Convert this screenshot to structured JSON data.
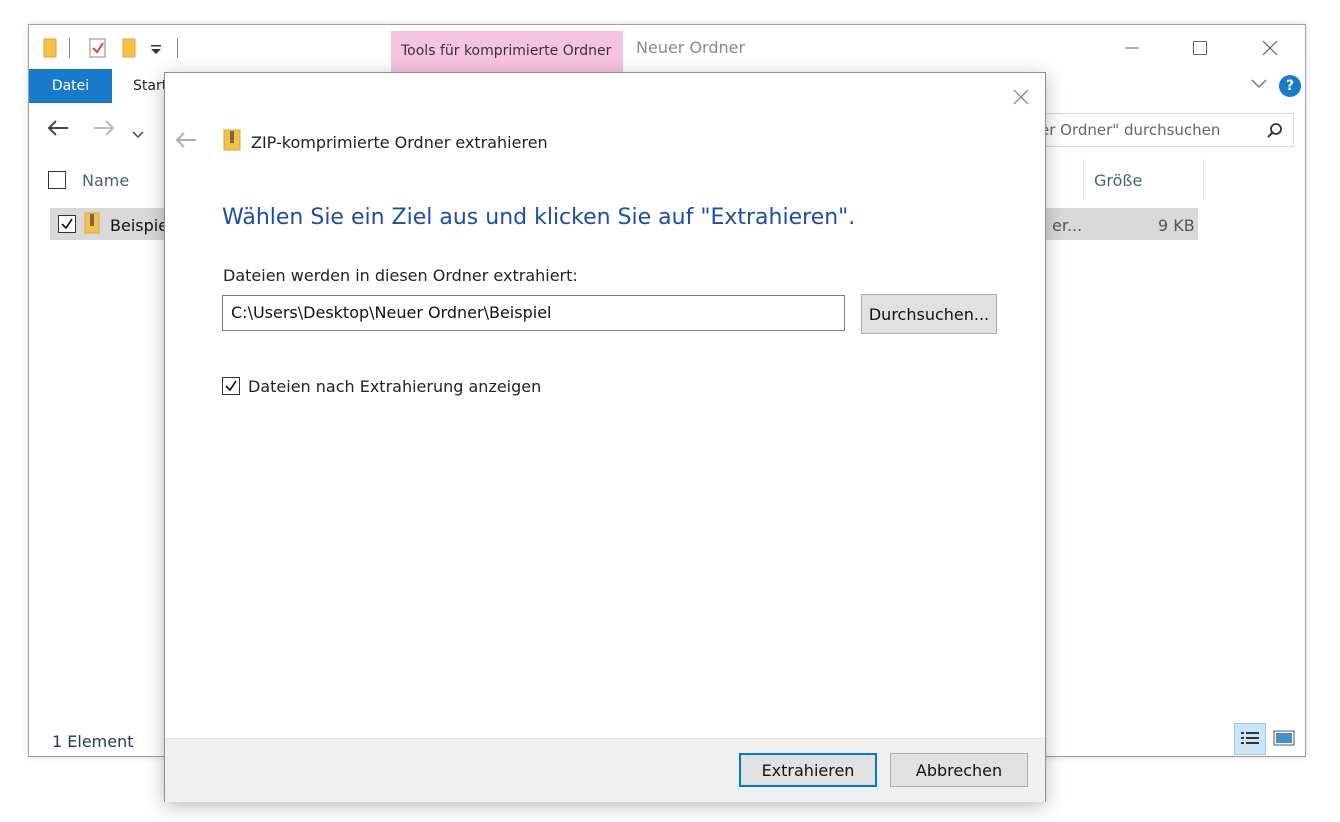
{
  "explorer": {
    "context_tab": "Tools für komprimierte Ordner",
    "window_title": "Neuer Ordner",
    "ribbon_tabs": [
      "Datei",
      "Start"
    ],
    "search_placeholder": "er Ordner\" durchsuchen",
    "columns": {
      "name": "Name",
      "size": "Größe"
    },
    "file": {
      "name": "Beispie",
      "type_partial": "er...",
      "size": "9 KB"
    },
    "status": "1 Element",
    "help_label": "?"
  },
  "dialog": {
    "header_title": "ZIP-komprimierte Ordner extrahieren",
    "heading": "Wählen Sie ein Ziel aus und klicken Sie auf \"Extrahieren\".",
    "folder_label": "Dateien werden in diesen Ordner extrahiert:",
    "path_value": "C:\\Users\\Desktop\\Neuer Ordner\\Beispiel",
    "browse_label": "Durchsuchen...",
    "show_files_label": "Dateien nach Extrahierung anzeigen",
    "show_files_checked": true,
    "extract_label": "Extrahieren",
    "cancel_label": "Abbrechen"
  },
  "colors": {
    "accent": "#1979ca",
    "context_tab": "#f7c4e0",
    "heading": "#1e4ea0",
    "default_button_border": "#0078d7"
  }
}
